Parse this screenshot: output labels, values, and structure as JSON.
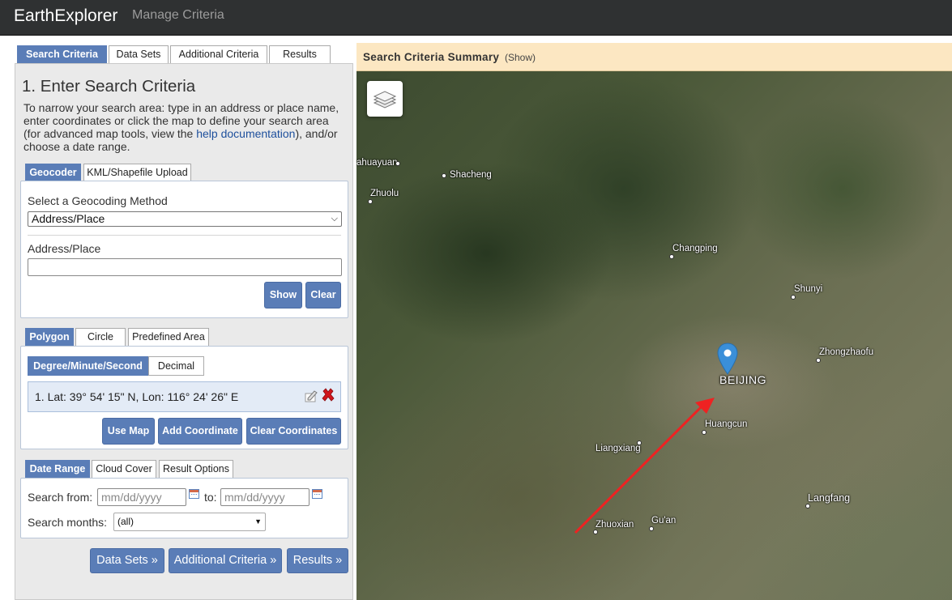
{
  "navbar": {
    "brand": "EarthExplorer",
    "link": "Manage Criteria"
  },
  "main_tabs": [
    "Search Criteria",
    "Data Sets",
    "Additional Criteria",
    "Results"
  ],
  "section": {
    "title": "1. Enter Search Criteria",
    "intro_before_link": "To narrow your search area: type in an address or place name, enter coordinates or click the map to define your search area (for advanced map tools, view the ",
    "intro_link": "help documentation",
    "intro_after_link": "), and/or choose a date range."
  },
  "geo_tabs": [
    "Geocoder",
    "KML/Shapefile Upload"
  ],
  "geocoder": {
    "method_label": "Select a Geocoding Method",
    "method_value": "Address/Place",
    "address_label": "Address/Place",
    "address_value": "",
    "show_label": "Show",
    "clear_label": "Clear"
  },
  "area_tabs": [
    "Polygon",
    "Circle",
    "Predefined Area"
  ],
  "format_tabs": [
    "Degree/Minute/Second",
    "Decimal"
  ],
  "coordinates": [
    {
      "text": "1.  Lat: 39° 54' 15\" N, Lon: 116° 24' 26\" E"
    }
  ],
  "coord_buttons": {
    "use_map": "Use Map",
    "add": "Add Coordinate",
    "clear": "Clear Coordinates"
  },
  "date_tabs": [
    "Date Range",
    "Cloud Cover",
    "Result Options"
  ],
  "date": {
    "from_label": "Search from:",
    "from_placeholder": "mm/dd/yyyy",
    "to_label": "to:",
    "to_placeholder": "mm/dd/yyyy",
    "months_label": "Search months:",
    "months_value": "(all)"
  },
  "bottom_buttons": {
    "datasets": "Data Sets »",
    "additional": "Additional Criteria »",
    "results": "Results »"
  },
  "map": {
    "summary_title": "Search Criteria Summary",
    "summary_toggle": "(Show)",
    "places": {
      "huayuan": "ahuayuan",
      "shacheng": "Shacheng",
      "zhuolu": "Zhuolu",
      "changping": "Changping",
      "shunyi": "Shunyi",
      "zhongzhaofu": "Zhongzhaofu",
      "beijing": "BEIJING",
      "huangcun": "Huangcun",
      "liangxiang": "Liangxiang",
      "langfang": "Langfang",
      "zhuoxian": "Zhuoxian",
      "guan": "Gu'an"
    },
    "marker_color": "#3a8fd9",
    "arrow_color": "#ee2222"
  }
}
